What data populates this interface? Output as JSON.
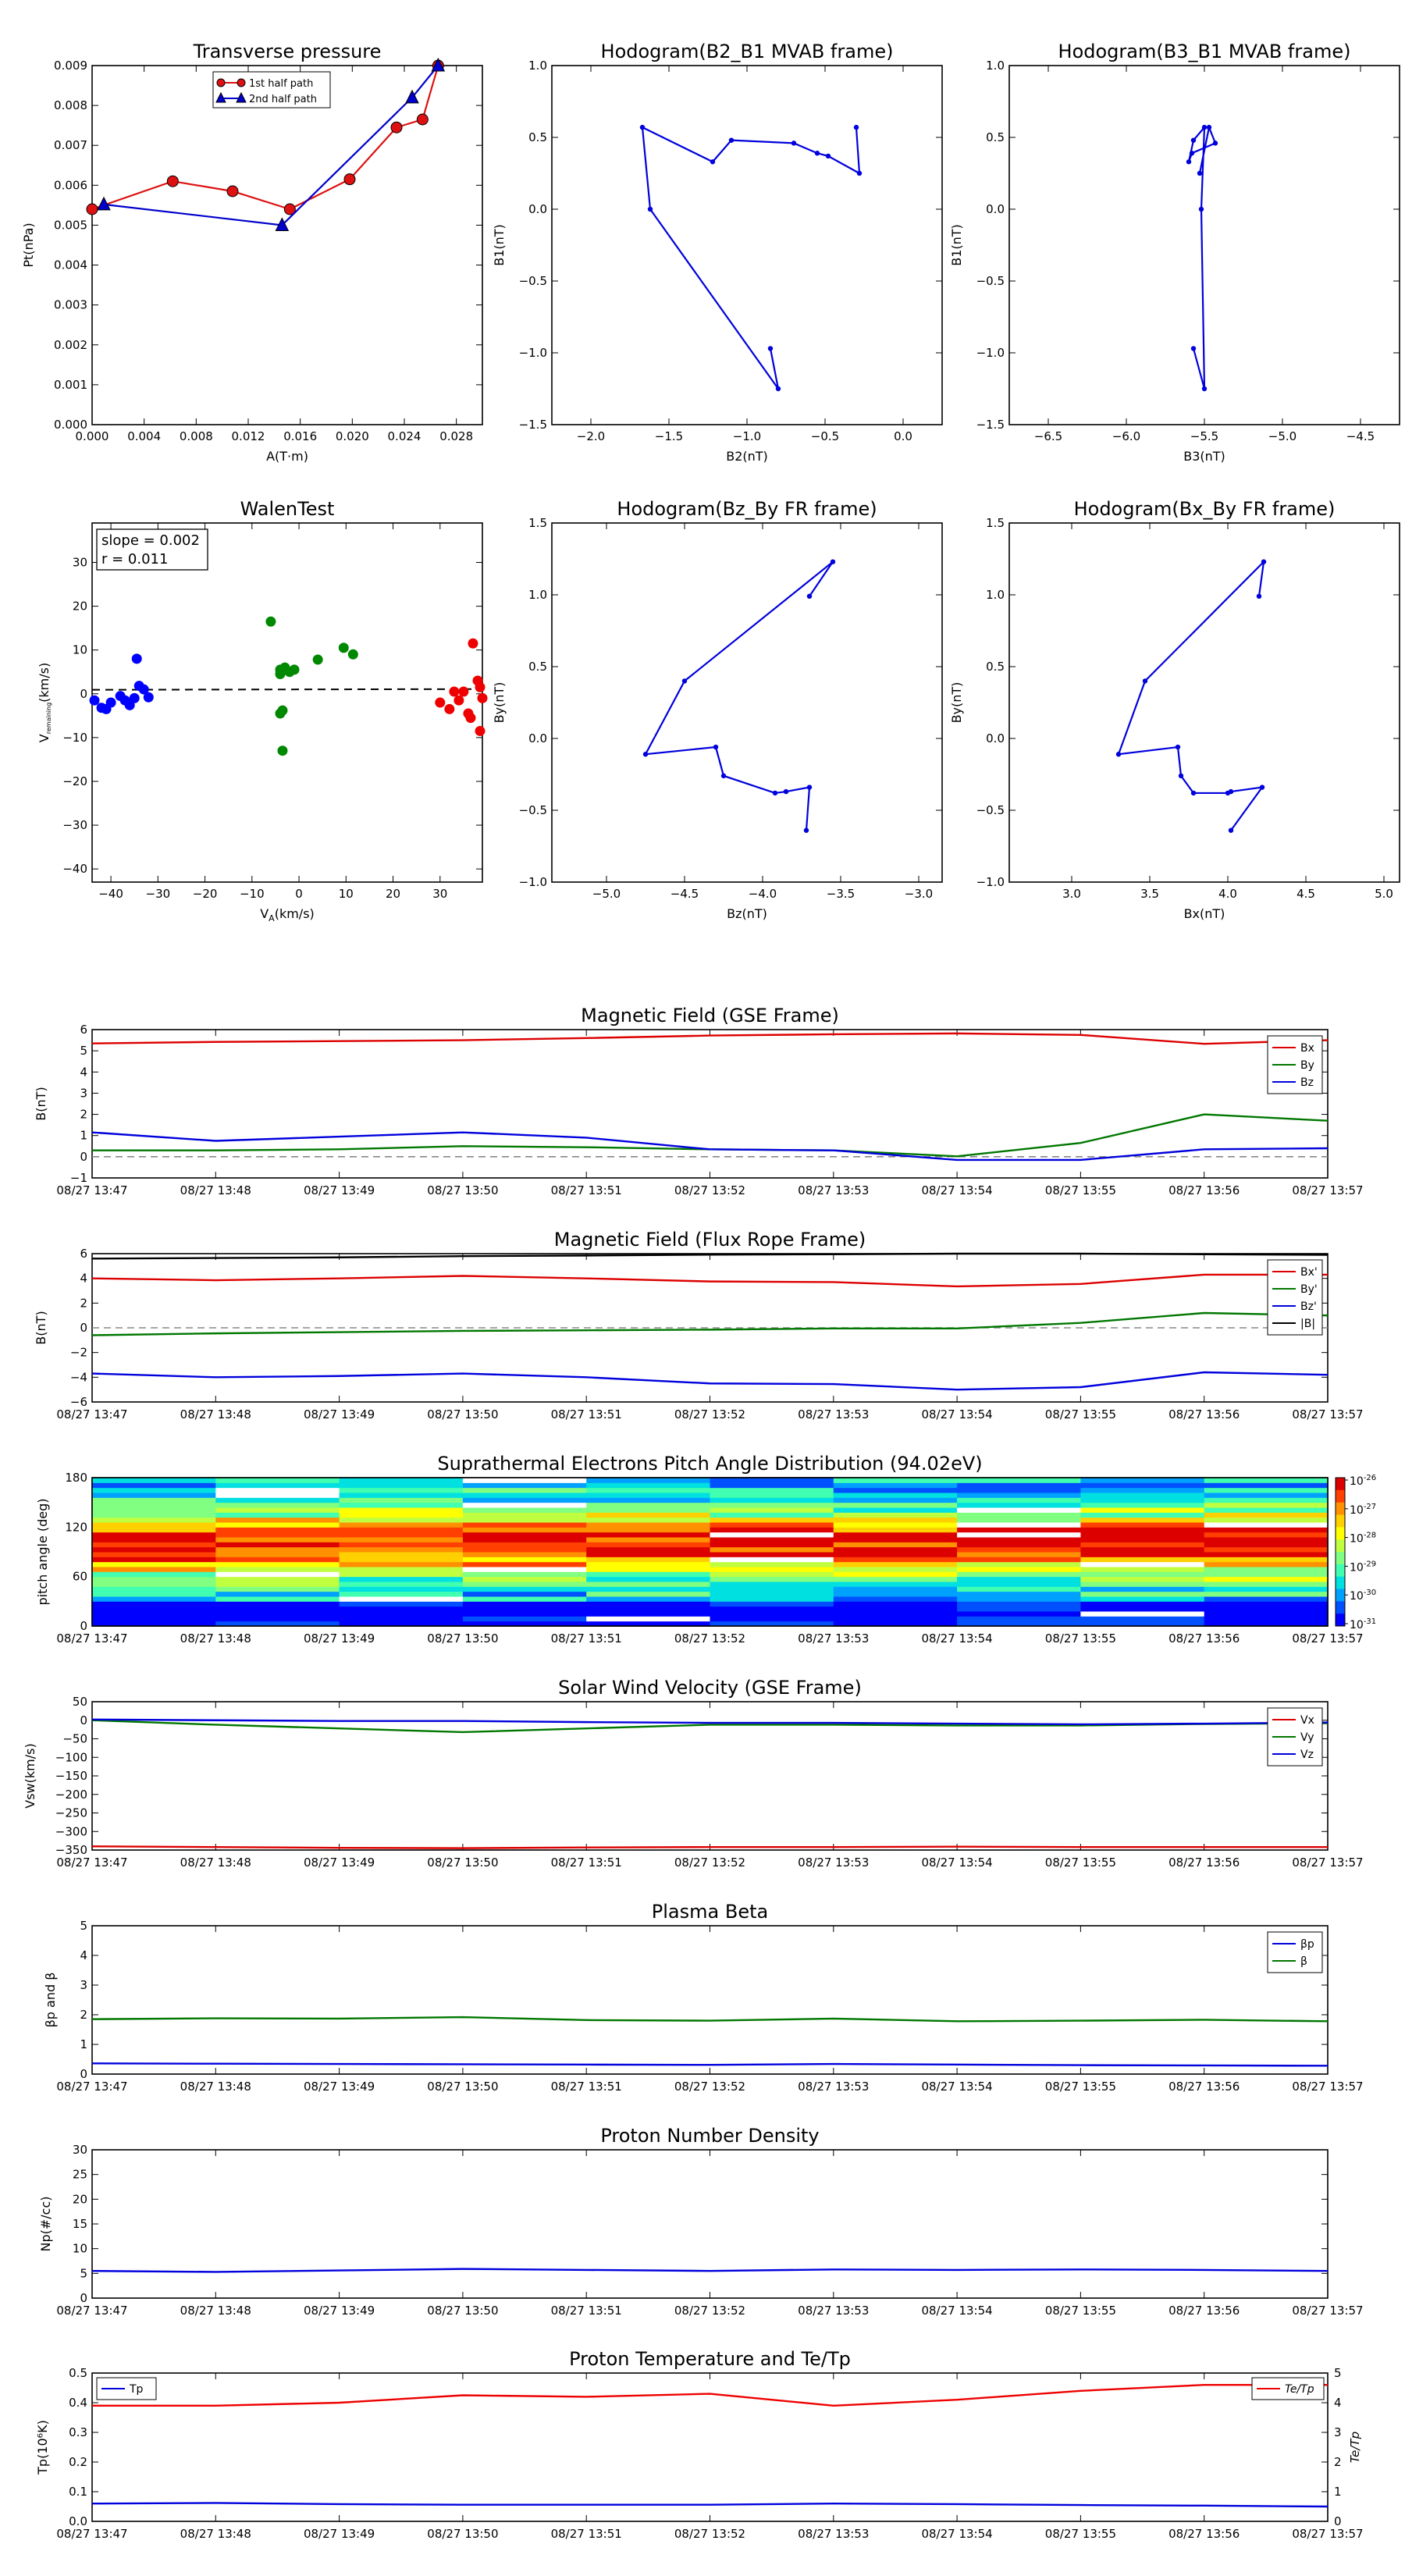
{
  "figure": {
    "time_ticks": [
      "08/27 13:47",
      "08/27 13:48",
      "08/27 13:49",
      "08/27 13:50",
      "08/27 13:51",
      "08/27 13:52",
      "08/27 13:53",
      "08/27 13:54",
      "08/27 13:55",
      "08/27 13:56",
      "08/27 13:57"
    ]
  },
  "chart_data": [
    {
      "id": "transverse_pressure",
      "type": "line",
      "title": "Transverse pressure",
      "xlabel": "A(T·m)",
      "ylabel": "Pt(nPa)",
      "xlim": [
        0,
        0.03
      ],
      "ylim": [
        0,
        0.009
      ],
      "xticks": [
        0.0,
        0.004,
        0.008,
        0.012,
        0.016,
        0.02,
        0.024,
        0.028
      ],
      "xtick_labels": [
        "0.000",
        "0.004",
        "0.008",
        "0.012",
        "0.016",
        "0.020",
        "0.024",
        "0.028"
      ],
      "yticks": [
        0.0,
        0.001,
        0.002,
        0.003,
        0.004,
        0.005,
        0.006,
        0.007,
        0.008,
        0.009
      ],
      "ytick_labels": [
        "0.000",
        "0.001",
        "0.002",
        "0.003",
        "0.004",
        "0.005",
        "0.006",
        "0.007",
        "0.008",
        "0.009"
      ],
      "legend_position": "top-center",
      "series": [
        {
          "name": "1st half path",
          "color": "#dd1111",
          "marker": "circle",
          "x": [
            0.0,
            0.0062,
            0.0108,
            0.0152,
            0.0198,
            0.0234,
            0.0254,
            0.0266
          ],
          "y": [
            0.0054,
            0.0061,
            0.00585,
            0.0054,
            0.00615,
            0.00745,
            0.00765,
            0.009
          ]
        },
        {
          "name": "2nd half path",
          "color": "#0000cc",
          "marker": "triangle",
          "x": [
            0.0266,
            0.0246,
            0.0146,
            0.0009
          ],
          "y": [
            0.009,
            0.0082,
            0.005,
            0.00552
          ]
        }
      ]
    },
    {
      "id": "hodogram_mvab_b2_b1",
      "type": "line",
      "title": "Hodogram(B2_B1 MVAB frame)",
      "xlabel": "B2(nT)",
      "ylabel": "B1(nT)",
      "xlim": [
        -2.25,
        0.25
      ],
      "ylim": [
        -1.5,
        1.0
      ],
      "xticks": [
        -2.0,
        -1.5,
        -1.0,
        -0.5,
        0.0
      ],
      "xtick_labels": [
        "−2.0",
        "−1.5",
        "−1.0",
        "−0.5",
        "0.0"
      ],
      "yticks": [
        -1.5,
        -1.0,
        -0.5,
        0.0,
        0.5,
        1.0
      ],
      "ytick_labels": [
        "−1.5",
        "−1.0",
        "−0.5",
        "0.0",
        "0.5",
        "1.0"
      ],
      "series": [
        {
          "color": "#0000dd",
          "x": [
            -0.85,
            -0.8,
            -1.62,
            -1.67,
            -1.22,
            -1.1,
            -0.7,
            -0.55,
            -0.48,
            -0.28,
            -0.3
          ],
          "y": [
            -0.97,
            -1.25,
            0.0,
            0.57,
            0.33,
            0.48,
            0.46,
            0.39,
            0.37,
            0.25,
            0.57
          ]
        }
      ]
    },
    {
      "id": "hodogram_mvab_b3_b1",
      "type": "line",
      "title": "Hodogram(B3_B1 MVAB frame)",
      "xlabel": "B3(nT)",
      "ylabel": "B1(nT)",
      "xlim": [
        -6.75,
        -4.25
      ],
      "ylim": [
        -1.5,
        1.0
      ],
      "xticks": [
        -6.5,
        -6.0,
        -5.5,
        -5.0,
        -4.5
      ],
      "xtick_labels": [
        "−6.5",
        "−6.0",
        "−5.5",
        "−5.0",
        "−4.5"
      ],
      "yticks": [
        -1.5,
        -1.0,
        -0.5,
        0.0,
        0.5,
        1.0
      ],
      "ytick_labels": [
        "−1.5",
        "−1.0",
        "−0.5",
        "0.0",
        "0.5",
        "1.0"
      ],
      "series": [
        {
          "color": "#0000dd",
          "x": [
            -5.57,
            -5.5,
            -5.52,
            -5.5,
            -5.57,
            -5.6,
            -5.58,
            -5.43,
            -5.47,
            -5.53
          ],
          "y": [
            -0.97,
            -1.25,
            0.0,
            0.57,
            0.48,
            0.33,
            0.39,
            0.46,
            0.57,
            0.25
          ]
        }
      ]
    },
    {
      "id": "walen_test",
      "type": "scatter",
      "title": "WalenTest",
      "xlabel": "Vₐ(km/s)",
      "xlabel_main": "V",
      "xlabel_sub": "A",
      "xlabel_tail": "(km/s)",
      "ylabel_main": "V",
      "ylabel_sub": "remaining",
      "ylabel_tail": "(km/s)",
      "xlim": [
        -44,
        39
      ],
      "ylim": [
        -43,
        39
      ],
      "xticks": [
        -40,
        -30,
        -20,
        -10,
        0,
        10,
        20,
        30
      ],
      "xtick_labels": [
        "−40",
        "−30",
        "−20",
        "−10",
        "0",
        "10",
        "20",
        "30"
      ],
      "yticks": [
        -40,
        -30,
        -20,
        -10,
        0,
        10,
        20,
        30
      ],
      "ytick_labels": [
        "−40",
        "−30",
        "−20",
        "−10",
        "0",
        "10",
        "20",
        "30"
      ],
      "annotation_line1": "slope = 0.002",
      "annotation_line2": "r = 0.011",
      "fit_line": {
        "slope": 0.002,
        "intercept": 1.0
      },
      "series": [
        {
          "color": "#0000ff",
          "x": [
            -43.5,
            -42,
            -41,
            -40,
            -38,
            -37,
            -36,
            -35,
            -34.5,
            -34,
            -33,
            -32
          ],
          "y": [
            -1.5,
            -3.2,
            -3.5,
            -2,
            -0.5,
            -1.5,
            -2.6,
            -1,
            8,
            1.8,
            1,
            -0.8
          ]
        },
        {
          "color": "#008800",
          "x": [
            -6,
            -4,
            -4,
            -3,
            -2,
            -1,
            -3.5,
            -4,
            -3.5,
            4,
            9.5,
            11.5
          ],
          "y": [
            16.5,
            4.5,
            5.5,
            6,
            5,
            5.5,
            -3.8,
            -4.5,
            -13,
            7.8,
            10.5,
            9
          ]
        },
        {
          "color": "#ee0000",
          "x": [
            30,
            32,
            33,
            34,
            35,
            36,
            36.5,
            37,
            38,
            38.5,
            38.5,
            39
          ],
          "y": [
            -2,
            -3.5,
            0.5,
            -1.5,
            0.5,
            -4.5,
            -5.5,
            11.5,
            3,
            1.5,
            -8.5,
            -1
          ]
        }
      ]
    },
    {
      "id": "hodogram_fr_bz_by",
      "type": "line",
      "title": "Hodogram(Bz_By FR frame)",
      "xlabel": "Bz(nT)",
      "ylabel": "By(nT)",
      "xlim": [
        -5.35,
        -2.85
      ],
      "ylim": [
        -1.0,
        1.5
      ],
      "xticks": [
        -5.0,
        -4.5,
        -4.0,
        -3.5,
        -3.0
      ],
      "xtick_labels": [
        "−5.0",
        "−4.5",
        "−4.0",
        "−3.5",
        "−3.0"
      ],
      "yticks": [
        -1.0,
        -0.5,
        0.0,
        0.5,
        1.0,
        1.5
      ],
      "ytick_labels": [
        "−1.0",
        "−0.5",
        "0.0",
        "0.5",
        "1.0",
        "1.5"
      ],
      "series": [
        {
          "color": "#0000dd",
          "x": [
            -3.7,
            -3.55,
            -4.5,
            -4.75,
            -4.3,
            -4.25,
            -3.92,
            -3.85,
            -3.7,
            -3.72
          ],
          "y": [
            0.99,
            1.23,
            0.4,
            -0.11,
            -0.06,
            -0.26,
            -0.38,
            -0.37,
            -0.34,
            -0.64
          ]
        }
      ]
    },
    {
      "id": "hodogram_fr_bx_by",
      "type": "line",
      "title": "Hodogram(Bx_By FR frame)",
      "xlabel": "Bx(nT)",
      "ylabel": "By(nT)",
      "xlim": [
        2.6,
        5.1
      ],
      "ylim": [
        -1.0,
        1.5
      ],
      "xticks": [
        3.0,
        3.5,
        4.0,
        4.5,
        5.0
      ],
      "xtick_labels": [
        "3.0",
        "3.5",
        "4.0",
        "4.5",
        "5.0"
      ],
      "yticks": [
        -1.0,
        -0.5,
        0.0,
        0.5,
        1.0,
        1.5
      ],
      "ytick_labels": [
        "−1.0",
        "−0.5",
        "0.0",
        "0.5",
        "1.0",
        "1.5"
      ],
      "series": [
        {
          "color": "#0000dd",
          "x": [
            4.2,
            4.23,
            3.47,
            3.3,
            3.68,
            3.7,
            3.78,
            4.0,
            4.02,
            4.22,
            4.02
          ],
          "y": [
            0.99,
            1.23,
            0.4,
            -0.11,
            -0.06,
            -0.26,
            -0.38,
            -0.38,
            -0.37,
            -0.34,
            -0.64
          ]
        }
      ]
    },
    {
      "id": "mag_field_gse",
      "type": "line",
      "title": "Magnetic Field (GSE Frame)",
      "ylabel": "B(nT)",
      "ylim": [
        -1,
        6
      ],
      "yticks": [
        -1,
        0,
        1,
        2,
        3,
        4,
        5,
        6
      ],
      "ytick_labels": [
        "−1",
        "0",
        "1",
        "2",
        "3",
        "4",
        "5",
        "6"
      ],
      "x": [
        0,
        1,
        2,
        3,
        4,
        5,
        6,
        7,
        8,
        9,
        10
      ],
      "legend_position": "top-right",
      "zero_line": true,
      "series": [
        {
          "name": "Bx",
          "color": "#dd0000",
          "values": [
            5.35,
            5.42,
            5.46,
            5.5,
            5.6,
            5.72,
            5.78,
            5.82,
            5.75,
            5.33,
            5.5
          ]
        },
        {
          "name": "By",
          "color": "#007700",
          "values": [
            0.3,
            0.3,
            0.35,
            0.5,
            0.45,
            0.35,
            0.3,
            0.02,
            0.65,
            2.0,
            1.7
          ]
        },
        {
          "name": "Bz",
          "color": "#0000dd",
          "values": [
            1.15,
            0.75,
            0.95,
            1.15,
            0.9,
            0.35,
            0.3,
            -0.15,
            -0.15,
            0.35,
            0.4
          ]
        }
      ]
    },
    {
      "id": "mag_field_fr",
      "type": "line",
      "title": "Magnetic Field (Flux Rope Frame)",
      "ylabel": "B(nT)",
      "ylim": [
        -6,
        6
      ],
      "yticks": [
        -6,
        -4,
        -2,
        0,
        2,
        4,
        6
      ],
      "ytick_labels": [
        "−6",
        "−4",
        "−2",
        "0",
        "2",
        "4",
        "6"
      ],
      "x": [
        0,
        1,
        2,
        3,
        4,
        5,
        6,
        7,
        8,
        9,
        10
      ],
      "legend_position": "top-right",
      "zero_line": true,
      "series": [
        {
          "name": "Bx'",
          "color": "#dd0000",
          "values": [
            4.0,
            3.85,
            4.0,
            4.2,
            4.0,
            3.75,
            3.7,
            3.35,
            3.55,
            4.3,
            4.3
          ]
        },
        {
          "name": "By'",
          "color": "#007700",
          "values": [
            -0.6,
            -0.45,
            -0.35,
            -0.25,
            -0.2,
            -0.15,
            -0.05,
            -0.05,
            0.4,
            1.2,
            1.0
          ]
        },
        {
          "name": "Bz'",
          "color": "#0000dd",
          "values": [
            -3.7,
            -4.0,
            -3.9,
            -3.7,
            -4.0,
            -4.5,
            -4.55,
            -5.0,
            -4.8,
            -3.6,
            -3.8
          ]
        },
        {
          "name": "|B|",
          "color": "#000000",
          "values": [
            5.6,
            5.65,
            5.7,
            5.8,
            5.85,
            5.92,
            5.95,
            6.0,
            6.0,
            5.95,
            5.9
          ]
        }
      ]
    },
    {
      "id": "electron_pad",
      "type": "heatmap",
      "title": "Suprathermal Electrons Pitch Angle Distribution (94.02eV)",
      "ylabel": "pitch angle (deg)",
      "ylim": [
        0,
        180
      ],
      "yticks": [
        0,
        60,
        120,
        180
      ],
      "ytick_labels": [
        "0",
        "60",
        "120",
        "180"
      ],
      "colorbar_exponents": [
        "-26",
        "-27",
        "-28",
        "-29",
        "-30",
        "-31"
      ],
      "colorbar_base": "10",
      "columns": 10,
      "bins": 30
    },
    {
      "id": "solar_wind_velocity",
      "type": "line",
      "title": "Solar Wind Velocity (GSE Frame)",
      "ylabel": "Vsw(km/s)",
      "ylim": [
        -350,
        50
      ],
      "yticks": [
        -350,
        -300,
        -250,
        -200,
        -150,
        -100,
        -50,
        0,
        50
      ],
      "ytick_labels": [
        "−350",
        "−300",
        "−250",
        "−200",
        "−150",
        "−100",
        "−50",
        "0",
        "50"
      ],
      "x": [
        0,
        1,
        2,
        3,
        4,
        5,
        6,
        7,
        8,
        9,
        10
      ],
      "legend_position": "top-right",
      "series": [
        {
          "name": "Vx",
          "color": "#dd0000",
          "values": [
            -340,
            -342,
            -344,
            -345,
            -343,
            -342,
            -342,
            -341,
            -342,
            -342,
            -342
          ]
        },
        {
          "name": "Vy",
          "color": "#007700",
          "values": [
            0,
            -12,
            -22,
            -32,
            -22,
            -12,
            -12,
            -14,
            -14,
            -10,
            -8
          ]
        },
        {
          "name": "Vz",
          "color": "#0000dd",
          "values": [
            2,
            0,
            -2,
            -2,
            -5,
            -7,
            -7,
            -9,
            -11,
            -9,
            -6
          ]
        }
      ]
    },
    {
      "id": "plasma_beta",
      "type": "line",
      "title": "Plasma Beta",
      "ylabel": "βp and β",
      "ylim": [
        0,
        5
      ],
      "yticks": [
        0,
        1,
        2,
        3,
        4,
        5
      ],
      "ytick_labels": [
        "0",
        "1",
        "2",
        "3",
        "4",
        "5"
      ],
      "x": [
        0,
        1,
        2,
        3,
        4,
        5,
        6,
        7,
        8,
        9,
        10
      ],
      "legend_position": "top-right",
      "series": [
        {
          "name": "βp",
          "color": "#0000dd",
          "values": [
            0.36,
            0.35,
            0.34,
            0.33,
            0.32,
            0.31,
            0.34,
            0.32,
            0.3,
            0.29,
            0.28
          ]
        },
        {
          "name": "β",
          "color": "#007700",
          "values": [
            1.85,
            1.88,
            1.87,
            1.92,
            1.82,
            1.8,
            1.87,
            1.78,
            1.8,
            1.83,
            1.78
          ]
        }
      ]
    },
    {
      "id": "proton_density",
      "type": "line",
      "title": "Proton Number Density",
      "ylabel": "Np(#/cc)",
      "ylim": [
        0,
        30
      ],
      "yticks": [
        0,
        5,
        10,
        15,
        20,
        25,
        30
      ],
      "ytick_labels": [
        "0",
        "5",
        "10",
        "15",
        "20",
        "25",
        "30"
      ],
      "x": [
        0,
        1,
        2,
        3,
        4,
        5,
        6,
        7,
        8,
        9,
        10
      ],
      "series": [
        {
          "color": "#0000dd",
          "values": [
            5.5,
            5.3,
            5.6,
            5.9,
            5.7,
            5.5,
            5.8,
            5.7,
            5.8,
            5.7,
            5.5
          ]
        }
      ]
    },
    {
      "id": "proton_temperature",
      "type": "line",
      "title": "Proton Temperature and Te/Tp",
      "ylabel": "Tp(10⁶K)",
      "ylim": [
        0,
        0.5
      ],
      "yticks": [
        0.0,
        0.1,
        0.2,
        0.3,
        0.4,
        0.5
      ],
      "ytick_labels": [
        "0.0",
        "0.1",
        "0.2",
        "0.3",
        "0.4",
        "0.5"
      ],
      "y2label": "Te/Tp",
      "y2lim": [
        0,
        5
      ],
      "y2ticks": [
        0,
        1,
        2,
        3,
        4,
        5
      ],
      "y2tick_labels": [
        "0",
        "1",
        "2",
        "3",
        "4",
        "5"
      ],
      "x": [
        0,
        1,
        2,
        3,
        4,
        5,
        6,
        7,
        8,
        9,
        10
      ],
      "series": [
        {
          "name": "Tp",
          "color": "#0000dd",
          "axis": "left",
          "values": [
            0.06,
            0.062,
            0.058,
            0.056,
            0.056,
            0.056,
            0.06,
            0.058,
            0.055,
            0.053,
            0.05
          ]
        },
        {
          "name": "Te/Tp",
          "color": "#ee0000",
          "axis": "right",
          "values": [
            3.9,
            3.9,
            4.0,
            4.25,
            4.2,
            4.3,
            3.9,
            4.1,
            4.4,
            4.6,
            4.6
          ]
        }
      ]
    }
  ]
}
